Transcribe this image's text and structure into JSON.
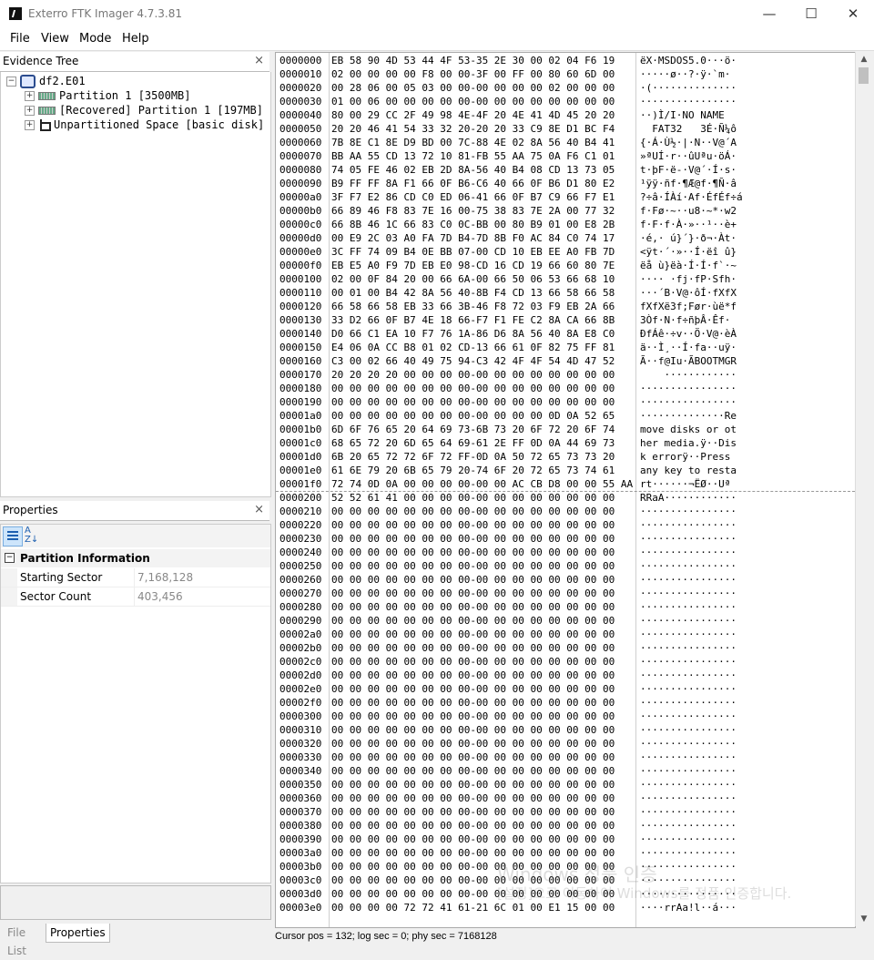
{
  "window": {
    "title": "Exterro FTK Imager 4.7.3.81",
    "minimize": "—",
    "maximize": "☐",
    "close": "✕"
  },
  "menu": [
    "File",
    "View",
    "Mode",
    "Help"
  ],
  "evidence_tree": {
    "title": "Evidence Tree",
    "close": "×",
    "root": "df2.E01",
    "items": [
      "Partition 1 [3500MB]",
      "[Recovered] Partition 1 [197MB]",
      "Unpartitioned Space [basic disk]"
    ]
  },
  "properties": {
    "title": "Properties",
    "close": "×",
    "category": "Partition Information",
    "rows": [
      {
        "key": "Starting Sector",
        "value": "7,168,128"
      },
      {
        "key": "Sector Count",
        "value": "403,456"
      }
    ]
  },
  "bottom_tabs": [
    "File List",
    "Properties"
  ],
  "status": "Cursor pos = 132; log sec = 0; phy sec = 7168128",
  "watermark": {
    "line1": "Windows 정품 인증",
    "line2": "[설정]으로 이동하여 Windows를 정품 인증합니다."
  },
  "hex": [
    {
      "off": "0000000",
      "bytes": "EB 58 90 4D 53 44 4F 53-35 2E 30 00 02 04 F6 19",
      "ascii": "ëX·MSDOS5.0···ö·"
    },
    {
      "off": "0000010",
      "bytes": "02 00 00 00 00 F8 00 00-3F 00 FF 00 80 60 6D 00",
      "ascii": "·····ø··?·ÿ·`m·"
    },
    {
      "off": "0000020",
      "bytes": "00 28 06 00 05 03 00 00-00 00 00 00 02 00 00 00",
      "ascii": "·(··············"
    },
    {
      "off": "0000030",
      "bytes": "01 00 06 00 00 00 00 00-00 00 00 00 00 00 00 00",
      "ascii": "················"
    },
    {
      "off": "0000040",
      "bytes": "80 00 29 CC 2F 49 98 4E-4F 20 4E 41 4D 45 20 20",
      "ascii": "··)Ì/I·NO NAME  "
    },
    {
      "off": "0000050",
      "bytes": "20 20 46 41 54 33 32 20-20 20 33 C9 8E D1 BC F4",
      "ascii": "  FAT32   3É·Ñ¼ô"
    },
    {
      "off": "0000060",
      "bytes": "7B 8E C1 8E D9 BD 00 7C-88 4E 02 8A 56 40 B4 41",
      "ascii": "{·Á·Ù½·|·N··V@´A"
    },
    {
      "off": "0000070",
      "bytes": "BB AA 55 CD 13 72 10 81-FB 55 AA 75 0A F6 C1 01",
      "ascii": "»ªUÍ·r··ûUªu·öÁ·"
    },
    {
      "off": "0000080",
      "bytes": "74 05 FE 46 02 EB 2D 8A-56 40 B4 08 CD 13 73 05",
      "ascii": "t·þF·ë-·V@´·Í·s·"
    },
    {
      "off": "0000090",
      "bytes": "B9 FF FF 8A F1 66 0F B6-C6 40 66 0F B6 D1 80 E2",
      "ascii": "¹ÿÿ·ñf·¶Æ@f·¶Ñ·â"
    },
    {
      "off": "00000a0",
      "bytes": "3F F7 E2 86 CD C0 ED 06-41 66 0F B7 C9 66 F7 E1",
      "ascii": "?÷â·ÍÀí·Af·ÉfÉf÷á"
    },
    {
      "off": "00000b0",
      "bytes": "66 89 46 F8 83 7E 16 00-75 38 83 7E 2A 00 77 32",
      "ascii": "f·Fø·~··u8·~*·w2"
    },
    {
      "off": "00000c0",
      "bytes": "66 8B 46 1C 66 83 C0 0C-BB 00 80 B9 01 00 E8 2B",
      "ascii": "f·F·f·À·»··¹··è+"
    },
    {
      "off": "00000d0",
      "bytes": "00 E9 2C 03 A0 FA 7D B4-7D 8B F0 AC 84 C0 74 17",
      "ascii": "·é,· ú}´}·ð¬·Àt·"
    },
    {
      "off": "00000e0",
      "bytes": "3C FF 74 09 B4 0E BB 07-00 CD 10 EB EE A0 FB 7D",
      "ascii": "<ÿt·´·»··Í·ëî û}"
    },
    {
      "off": "00000f0",
      "bytes": "EB E5 A0 F9 7D EB E0 98-CD 16 CD 19 66 60 80 7E",
      "ascii": "ëå ù}ëà·Í·Í·f`·~"
    },
    {
      "off": "0000100",
      "bytes": "02 00 0F 84 20 00 66 6A-00 66 50 06 53 66 68 10",
      "ascii": "···· ·fj·fP·Sfh·"
    },
    {
      "off": "0000110",
      "bytes": "00 01 00 B4 42 8A 56 40-8B F4 CD 13 66 58 66 58",
      "ascii": "···´B·V@·ôÍ·fXfX"
    },
    {
      "off": "0000120",
      "bytes": "66 58 66 58 EB 33 66 3B-46 F8 72 03 F9 EB 2A 66",
      "ascii": "fXfXë3f;Før·ùë*f"
    },
    {
      "off": "0000130",
      "bytes": "33 D2 66 0F B7 4E 18 66-F7 F1 FE C2 8A CA 66 8B",
      "ascii": "3Òf·N·f÷ñþÂ·Êf·"
    },
    {
      "off": "0000140",
      "bytes": "D0 66 C1 EA 10 F7 76 1A-86 D6 8A 56 40 8A E8 C0",
      "ascii": "ÐfÁê·÷v··Ö·V@·èÀ"
    },
    {
      "off": "0000150",
      "bytes": "E4 06 0A CC B8 01 02 CD-13 66 61 0F 82 75 FF 81",
      "ascii": "ä··Ì¸··Í·fa··uÿ·"
    },
    {
      "off": "0000160",
      "bytes": "C3 00 02 66 40 49 75 94-C3 42 4F 4F 54 4D 47 52",
      "ascii": "Ã··f@Iu·ÃBOOTMGR"
    },
    {
      "off": "0000170",
      "bytes": "20 20 20 20 00 00 00 00-00 00 00 00 00 00 00 00",
      "ascii": "    ············"
    },
    {
      "off": "0000180",
      "bytes": "00 00 00 00 00 00 00 00-00 00 00 00 00 00 00 00",
      "ascii": "················"
    },
    {
      "off": "0000190",
      "bytes": "00 00 00 00 00 00 00 00-00 00 00 00 00 00 00 00",
      "ascii": "················"
    },
    {
      "off": "00001a0",
      "bytes": "00 00 00 00 00 00 00 00-00 00 00 00 0D 0A 52 65",
      "ascii": "··············Re"
    },
    {
      "off": "00001b0",
      "bytes": "6D 6F 76 65 20 64 69 73-6B 73 20 6F 72 20 6F 74",
      "ascii": "move disks or ot"
    },
    {
      "off": "00001c0",
      "bytes": "68 65 72 20 6D 65 64 69-61 2E FF 0D 0A 44 69 73",
      "ascii": "her media.ÿ··Dis"
    },
    {
      "off": "00001d0",
      "bytes": "6B 20 65 72 72 6F 72 FF-0D 0A 50 72 65 73 73 20",
      "ascii": "k errorÿ··Press "
    },
    {
      "off": "00001e0",
      "bytes": "61 6E 79 20 6B 65 79 20-74 6F 20 72 65 73 74 61",
      "ascii": "any key to resta"
    },
    {
      "off": "00001f0",
      "bytes": "72 74 0D 0A 00 00 00 00-00 00 AC CB D8 00 00 55 AA",
      "ascii": "rt······¬ËØ··Uª"
    },
    {
      "off": "0000200",
      "bytes": "52 52 61 41 00 00 00 00-00 00 00 00 00 00 00 00",
      "ascii": "RRaA············"
    },
    {
      "off": "0000210",
      "bytes": "00 00 00 00 00 00 00 00-00 00 00 00 00 00 00 00",
      "ascii": "················"
    },
    {
      "off": "0000220",
      "bytes": "00 00 00 00 00 00 00 00-00 00 00 00 00 00 00 00",
      "ascii": "················"
    },
    {
      "off": "0000230",
      "bytes": "00 00 00 00 00 00 00 00-00 00 00 00 00 00 00 00",
      "ascii": "················"
    },
    {
      "off": "0000240",
      "bytes": "00 00 00 00 00 00 00 00-00 00 00 00 00 00 00 00",
      "ascii": "················"
    },
    {
      "off": "0000250",
      "bytes": "00 00 00 00 00 00 00 00-00 00 00 00 00 00 00 00",
      "ascii": "················"
    },
    {
      "off": "0000260",
      "bytes": "00 00 00 00 00 00 00 00-00 00 00 00 00 00 00 00",
      "ascii": "················"
    },
    {
      "off": "0000270",
      "bytes": "00 00 00 00 00 00 00 00-00 00 00 00 00 00 00 00",
      "ascii": "················"
    },
    {
      "off": "0000280",
      "bytes": "00 00 00 00 00 00 00 00-00 00 00 00 00 00 00 00",
      "ascii": "················"
    },
    {
      "off": "0000290",
      "bytes": "00 00 00 00 00 00 00 00-00 00 00 00 00 00 00 00",
      "ascii": "················"
    },
    {
      "off": "00002a0",
      "bytes": "00 00 00 00 00 00 00 00-00 00 00 00 00 00 00 00",
      "ascii": "················"
    },
    {
      "off": "00002b0",
      "bytes": "00 00 00 00 00 00 00 00-00 00 00 00 00 00 00 00",
      "ascii": "················"
    },
    {
      "off": "00002c0",
      "bytes": "00 00 00 00 00 00 00 00-00 00 00 00 00 00 00 00",
      "ascii": "················"
    },
    {
      "off": "00002d0",
      "bytes": "00 00 00 00 00 00 00 00-00 00 00 00 00 00 00 00",
      "ascii": "················"
    },
    {
      "off": "00002e0",
      "bytes": "00 00 00 00 00 00 00 00-00 00 00 00 00 00 00 00",
      "ascii": "················"
    },
    {
      "off": "00002f0",
      "bytes": "00 00 00 00 00 00 00 00-00 00 00 00 00 00 00 00",
      "ascii": "················"
    },
    {
      "off": "0000300",
      "bytes": "00 00 00 00 00 00 00 00-00 00 00 00 00 00 00 00",
      "ascii": "················"
    },
    {
      "off": "0000310",
      "bytes": "00 00 00 00 00 00 00 00-00 00 00 00 00 00 00 00",
      "ascii": "················"
    },
    {
      "off": "0000320",
      "bytes": "00 00 00 00 00 00 00 00-00 00 00 00 00 00 00 00",
      "ascii": "················"
    },
    {
      "off": "0000330",
      "bytes": "00 00 00 00 00 00 00 00-00 00 00 00 00 00 00 00",
      "ascii": "················"
    },
    {
      "off": "0000340",
      "bytes": "00 00 00 00 00 00 00 00-00 00 00 00 00 00 00 00",
      "ascii": "················"
    },
    {
      "off": "0000350",
      "bytes": "00 00 00 00 00 00 00 00-00 00 00 00 00 00 00 00",
      "ascii": "················"
    },
    {
      "off": "0000360",
      "bytes": "00 00 00 00 00 00 00 00-00 00 00 00 00 00 00 00",
      "ascii": "················"
    },
    {
      "off": "0000370",
      "bytes": "00 00 00 00 00 00 00 00-00 00 00 00 00 00 00 00",
      "ascii": "················"
    },
    {
      "off": "0000380",
      "bytes": "00 00 00 00 00 00 00 00-00 00 00 00 00 00 00 00",
      "ascii": "················"
    },
    {
      "off": "0000390",
      "bytes": "00 00 00 00 00 00 00 00-00 00 00 00 00 00 00 00",
      "ascii": "················"
    },
    {
      "off": "00003a0",
      "bytes": "00 00 00 00 00 00 00 00-00 00 00 00 00 00 00 00",
      "ascii": "················"
    },
    {
      "off": "00003b0",
      "bytes": "00 00 00 00 00 00 00 00-00 00 00 00 00 00 00 00",
      "ascii": "················"
    },
    {
      "off": "00003c0",
      "bytes": "00 00 00 00 00 00 00 00-00 00 00 00 00 00 00 00",
      "ascii": "················"
    },
    {
      "off": "00003d0",
      "bytes": "00 00 00 00 00 00 00 00-00 00 00 00 00 00 00 00",
      "ascii": "················"
    },
    {
      "off": "00003e0",
      "bytes": "00 00 00 00 72 72 41 61-21 6C 01 00 E1 15 00 00",
      "ascii": "····rrAa!l··á···"
    }
  ]
}
